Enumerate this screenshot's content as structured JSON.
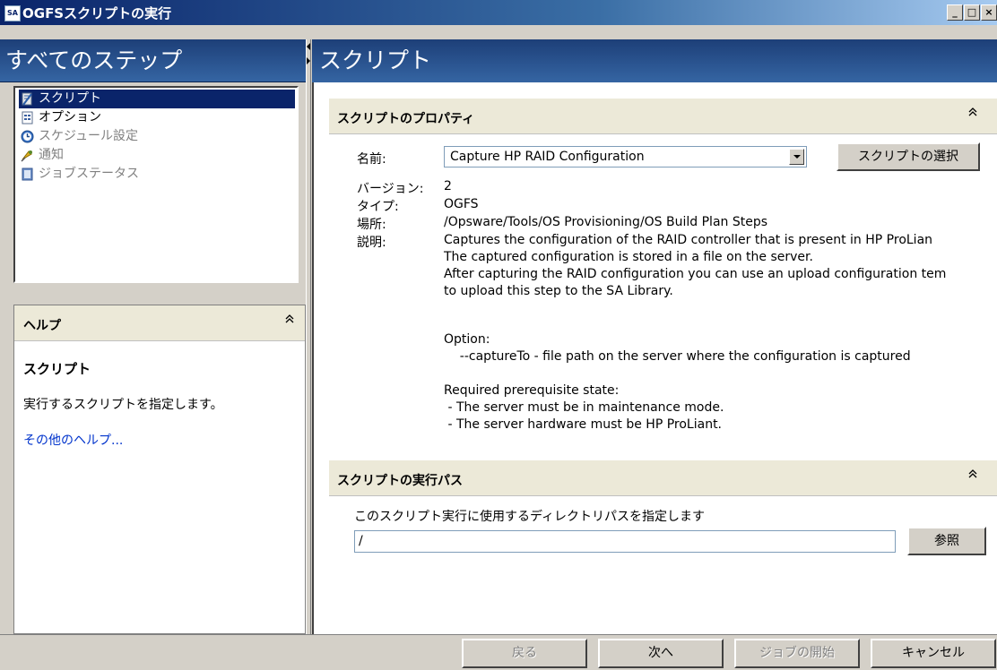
{
  "window": {
    "title": "OGFSスクリプトの実行",
    "icon_text": "SA",
    "min": "_",
    "max": "□",
    "close": "×"
  },
  "left": {
    "header": "すべてのステップ",
    "steps": [
      {
        "label": "スクリプト",
        "icon": "script-icon",
        "state": "active"
      },
      {
        "label": "オプション",
        "icon": "options-icon",
        "state": "normal"
      },
      {
        "label": "スケジュール設定",
        "icon": "schedule-icon",
        "state": "disabled"
      },
      {
        "label": "通知",
        "icon": "notification-icon",
        "state": "disabled"
      },
      {
        "label": "ジョブステータス",
        "icon": "job-status-icon",
        "state": "disabled"
      }
    ],
    "help": {
      "title": "ヘルプ",
      "chevron": "≪",
      "subtitle": "スクリプト",
      "text": "実行するスクリプトを指定します。",
      "link": "その他のヘルプ..."
    }
  },
  "right": {
    "header": "スクリプト",
    "properties": {
      "title": "スクリプトのプロパティ",
      "chevron": "≪",
      "name_label": "名前:",
      "name_value": "Capture HP RAID Configuration",
      "select_button": "スクリプトの選択",
      "version_label": "バージョン:",
      "version_value": "2",
      "type_label": "タイプ:",
      "type_value": "OGFS",
      "location_label": "場所:",
      "location_value": "/Opsware/Tools/OS Provisioning/OS Build Plan Steps",
      "description_label": "説明:",
      "description_lines": [
        "Captures the configuration of the RAID controller that is present in HP ProLian",
        "The captured configuration is stored in a file on the server.",
        "After capturing the RAID configuration you can use an upload configuration tem",
        "to upload this step to the SA Library.",
        "",
        "Option:",
        "    --captureTo - file path on the server where the configuration is captured",
        "",
        "Required prerequisite state:",
        " - The server must be in maintenance mode.",
        " - The server hardware must be HP ProLiant."
      ]
    },
    "exec_path": {
      "title": "スクリプトの実行パス",
      "chevron": "≪",
      "label": "このスクリプト実行に使用するディレクトリパスを指定します",
      "value": "/",
      "browse_button": "参照"
    }
  },
  "buttons": {
    "back": "戻る",
    "next": "次へ",
    "start_job": "ジョブの開始",
    "cancel": "キャンセル"
  }
}
